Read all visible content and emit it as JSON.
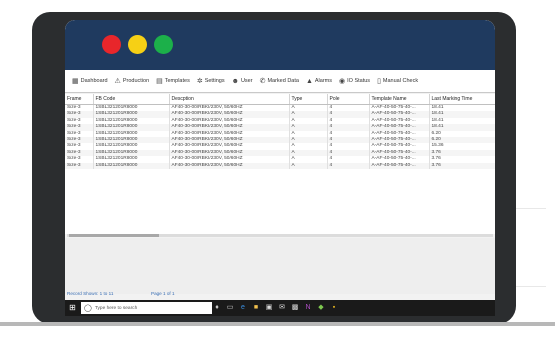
{
  "colors": {
    "header_bar": "#1f3a5f",
    "dot_red": "#e8262b",
    "dot_yellow": "#f6d015",
    "dot_green": "#1cb04a",
    "link_blue": "#3a6fb5"
  },
  "nav": [
    {
      "label": "Dashboard",
      "icon": "dashboard-icon",
      "glyph": "▦"
    },
    {
      "label": "Production",
      "icon": "production-icon",
      "glyph": "⚠"
    },
    {
      "label": "Templates",
      "icon": "templates-icon",
      "glyph": "▤"
    },
    {
      "label": "Settings",
      "icon": "gear-icon",
      "glyph": "✲"
    },
    {
      "label": "User",
      "icon": "users-icon",
      "glyph": "☻"
    },
    {
      "label": "Marked Data",
      "icon": "marked-data-icon",
      "glyph": "✆"
    },
    {
      "label": "Alarms",
      "icon": "alarm-icon",
      "glyph": "▲"
    },
    {
      "label": "IO Status",
      "icon": "io-status-icon",
      "glyph": "◉"
    },
    {
      "label": "Manual Check",
      "icon": "manual-check-icon",
      "glyph": "▯"
    }
  ],
  "table": {
    "columns": [
      "Frame",
      "FB Code",
      "Descption",
      "Type",
      "Pole",
      "Template Name",
      "Last Marking Time"
    ],
    "rows": [
      [
        "Size-3",
        "1SBL321201R8000",
        "AF40-30-00/RBKI/230V, 50/60HZ",
        "A",
        "4",
        "A-AF-40-50-75-40-...",
        "18.41"
      ],
      [
        "Size-3",
        "1SBL321201R8000",
        "AF40-30-00/RBKI/230V, 50/60HZ",
        "A",
        "4",
        "A-AF-40-50-75-40-...",
        "18.41"
      ],
      [
        "Size-3",
        "1SBL321201R8000",
        "AF40-30-00/RBKI/230V, 50/60HZ",
        "A",
        "4",
        "A-AF-40-50-75-40-...",
        "18.41"
      ],
      [
        "Size-3",
        "1SBL321201R8000",
        "AF40-30-00/RBKI/230V, 50/60HZ",
        "A",
        "4",
        "A-AF-40-50-75-40-...",
        "18.41"
      ],
      [
        "Size-3",
        "1SBL321201R8000",
        "AF40-30-00/RBKI/230V, 50/60HZ",
        "A",
        "4",
        "A-AF-40-50-75-40-...",
        "6.20"
      ],
      [
        "Size-3",
        "1SBL321201R8000",
        "AF40-30-00/RBKI/230V, 50/60HZ",
        "A",
        "4",
        "A-AF-40-50-75-40-...",
        "6.20"
      ],
      [
        "Size-3",
        "1SBL321201R8000",
        "AF40-30-00/RBKI/230V, 50/60HZ",
        "A",
        "4",
        "A-AF-40-50-75-40-...",
        "15.36"
      ],
      [
        "Size-3",
        "1SBL321201R8000",
        "AF40-30-00/RBKI/230V, 50/60HZ",
        "A",
        "4",
        "A-AF-40-50-75-40-...",
        "3.76"
      ],
      [
        "Size-3",
        "1SBL321201R8000",
        "AF40-30-00/RBKI/230V, 50/60HZ",
        "A",
        "4",
        "A-AF-40-50-75-40-...",
        "3.76"
      ],
      [
        "Size-3",
        "1SBL321201R8000",
        "AF40-30-00/RBKI/230V, 50/60HZ",
        "A",
        "4",
        "A-AF-40-50-75-40-...",
        "3.76"
      ]
    ]
  },
  "status": {
    "records": "Record Shown: 1 to 11",
    "page": "Page 1 of 1"
  },
  "taskbar": {
    "search_placeholder": "Type here to search",
    "icons": [
      {
        "name": "mic-icon",
        "glyph": "♦",
        "color": "#cccccc"
      },
      {
        "name": "task-view-icon",
        "glyph": "▭",
        "color": "#cccccc"
      },
      {
        "name": "edge-icon",
        "glyph": "e",
        "color": "#3b8fe0"
      },
      {
        "name": "file-explorer-icon",
        "glyph": "■",
        "color": "#f2c14e"
      },
      {
        "name": "store-icon",
        "glyph": "▣",
        "color": "#dddddd"
      },
      {
        "name": "mail-icon",
        "glyph": "✉",
        "color": "#dddddd"
      },
      {
        "name": "photos-icon",
        "glyph": "▩",
        "color": "#dddddd"
      },
      {
        "name": "onenote-icon",
        "glyph": "N",
        "color": "#b04fc6"
      },
      {
        "name": "teams-icon",
        "glyph": "◆",
        "color": "#7ec850"
      },
      {
        "name": "app-icon",
        "glyph": "▪",
        "color": "#e0b020"
      }
    ]
  }
}
